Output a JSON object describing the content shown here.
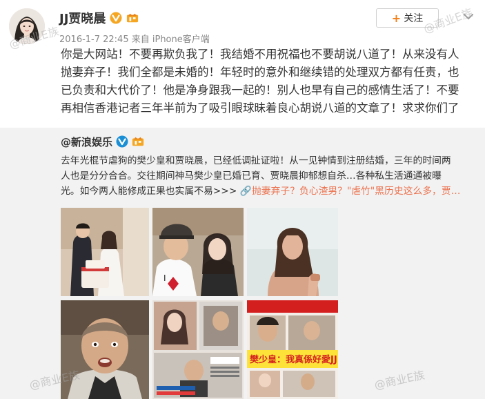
{
  "post": {
    "user_name": "JJ贾晓晨",
    "meta": "2016-1-7 22:45 来自 iPhone客户端",
    "follow_label": "关注",
    "follow_plus": "+",
    "text": "你是大网站！不要再欺负我了！我结婚不用祝福也不要胡说八道了！从来没有人\n抛妻弃子！我们全都是未婚的！年轻时的意外和继续错的处理双方都有任责，也\n已负责和大代价了！他是净身跟我一起的！别人也早有自己的感情生活了！不要\n再相信香港记者三年半前为了吸引眼球昧着良心胡说八道的文章了！求求你们了"
  },
  "repost": {
    "author": "@新浪娱乐",
    "text_main": "去年光棍节虐狗的樊少皇和贾晓晨，已经低调扯证啦！从一见钟情到注册结婚，三年的时间两\n人也是分分合合。交往期间神马樊少皇已婚已育、贾晓晨抑郁想自杀…各种私生活通通被曝\n光。如今两人能修成正果也实属不易>>> ",
    "link_text": "🔗抛妻弃子？负心渣男？\"虐竹\"黑历史这么多，贾…"
  },
  "photos": [
    {
      "name": "wedding-cake-photo"
    },
    {
      "name": "couple-selfie-photo"
    },
    {
      "name": "woman-portrait-photo"
    },
    {
      "name": "shaved-head-still-photo"
    },
    {
      "name": "magazine-collage-photo"
    },
    {
      "name": "magazine-cover-photo",
      "headline": "樊少皇：我真係好愛JJ"
    }
  ],
  "watermarks": {
    "top_left": "@商业E族",
    "right": "@商业E族",
    "bottom_left": "@商业E族",
    "bottom_right": "@商业E族"
  },
  "colors": {
    "accent_orange": "#f57f17",
    "link": "#eb7350",
    "repost_bg": "#f2f2f2",
    "badge_yellow": "#f5a623"
  }
}
